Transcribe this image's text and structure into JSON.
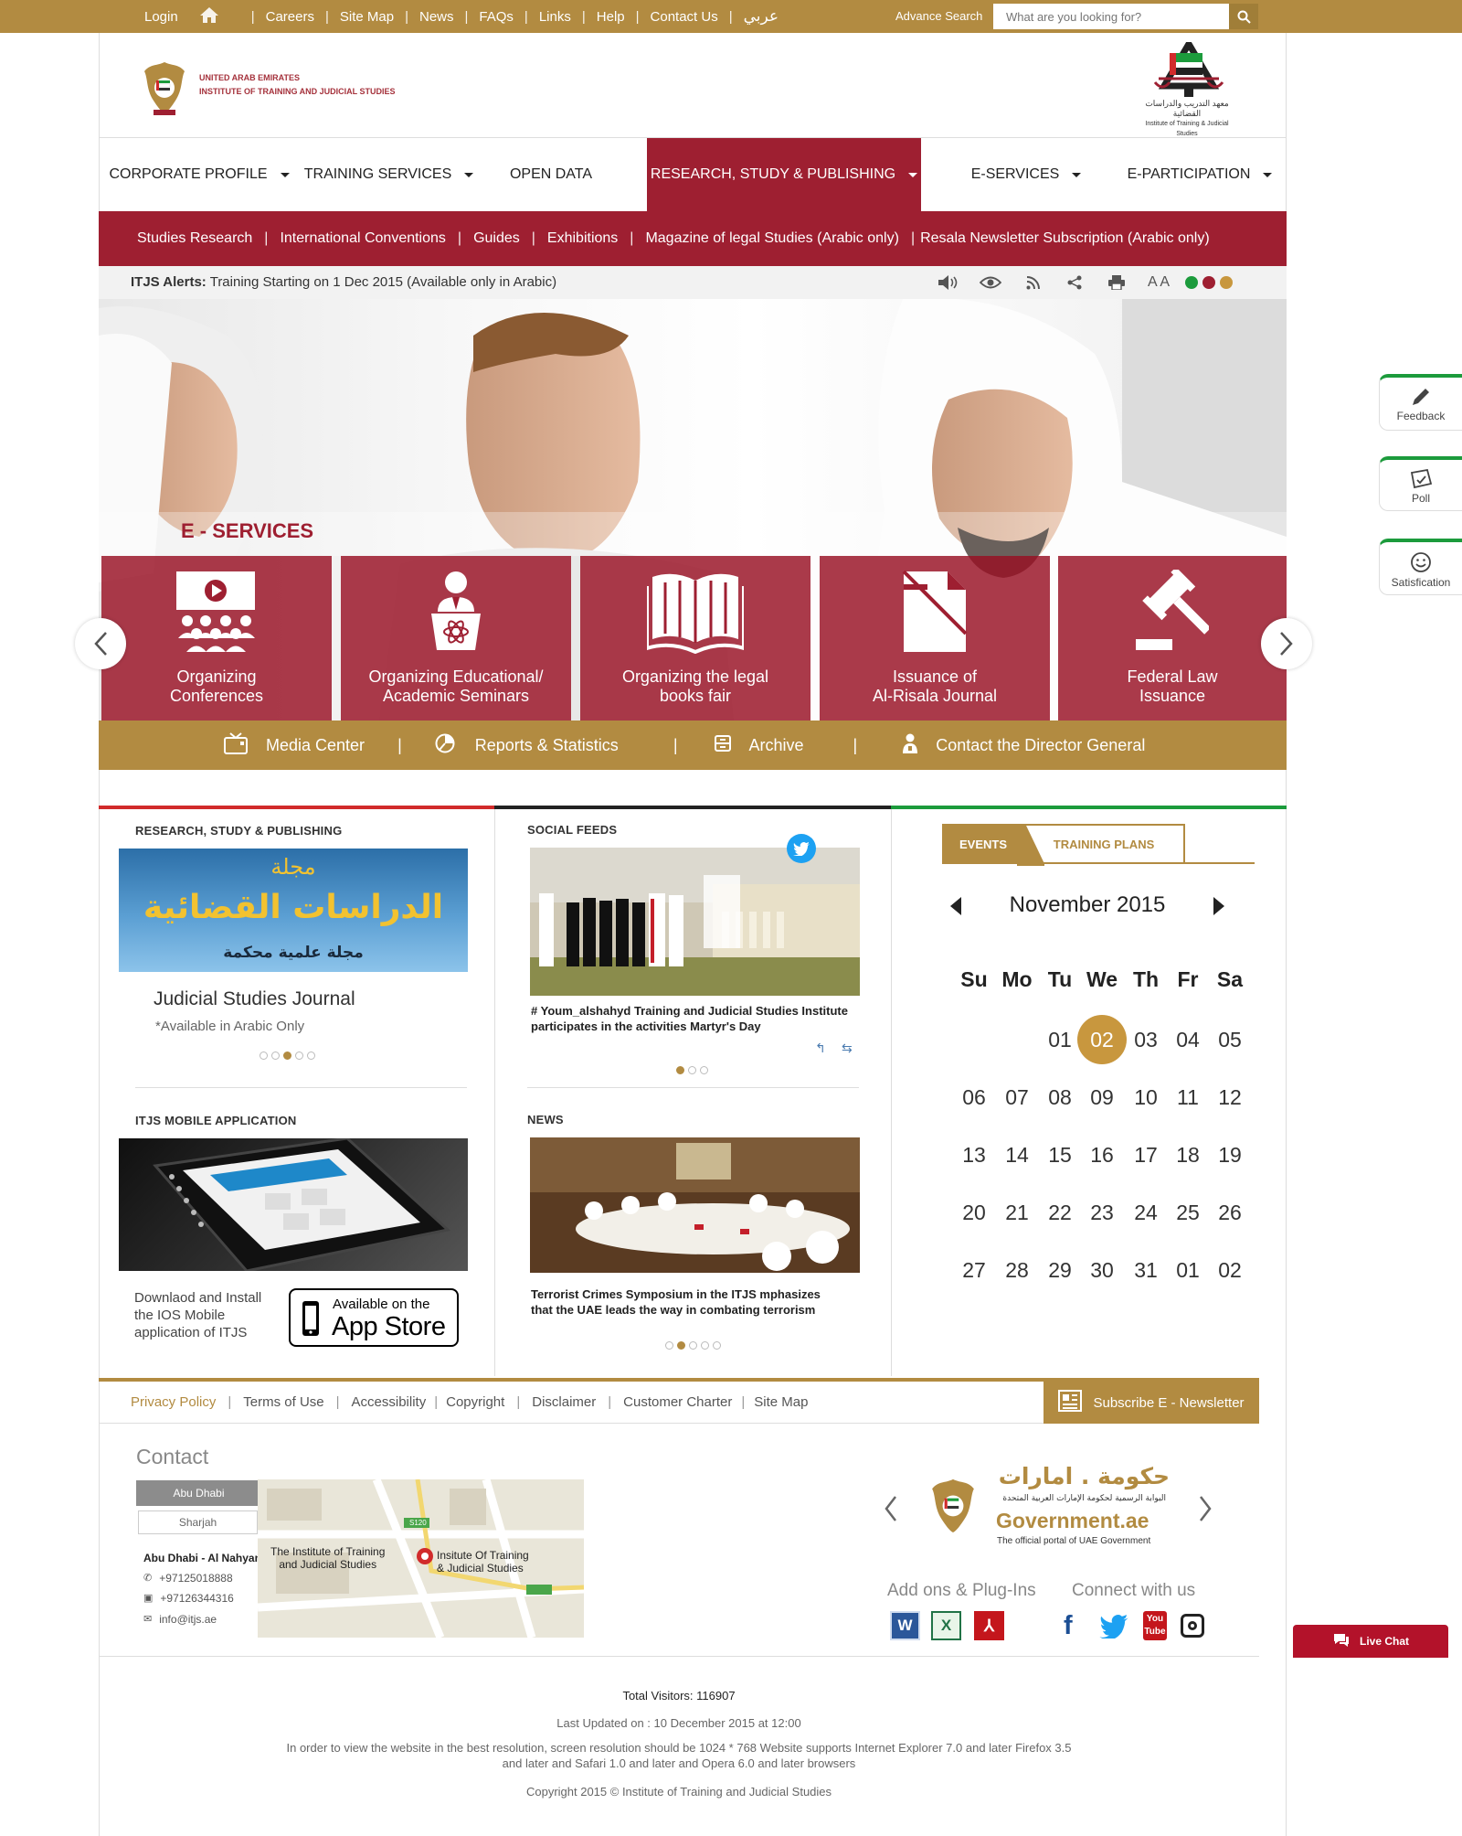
{
  "topbar": {
    "links": [
      "Login",
      "Careers",
      "Site Map",
      "News",
      "FAQs",
      "Links",
      "Help",
      "Contact Us",
      "عربي"
    ],
    "advance_search": "Advance Search",
    "search_placeholder": "What are you looking for?",
    "home_icon": "home-icon",
    "search_icon": "search-icon"
  },
  "header": {
    "logo_line1": "UNITED ARAB EMIRATES",
    "logo_line2": "INSTITUTE OF TRAINING AND JUDICIAL STUDIES",
    "logo_right_ar": "معهد التدريب والدراسات القضائية",
    "logo_right_en": "Institute of Training & Judicial Studies"
  },
  "mainnav": {
    "items": [
      {
        "label": "CORPORATE PROFILE",
        "dropdown": true
      },
      {
        "label": "TRAINING SERVICES",
        "dropdown": true
      },
      {
        "label": "OPEN DATA",
        "dropdown": false
      },
      {
        "label": "RESEARCH, STUDY & PUBLISHING",
        "dropdown": true,
        "active": true
      },
      {
        "label": "E-SERVICES",
        "dropdown": true
      },
      {
        "label": "E-PARTICIPATION",
        "dropdown": true
      }
    ]
  },
  "subnav": {
    "items": [
      "Studies Research",
      "International Conventions",
      "Guides",
      "Exhibitions",
      "Magazine of legal Studies (Arabic only)",
      "Resala Newsletter Subscription (Arabic only)"
    ]
  },
  "alerts": {
    "label": "ITJS Alerts:",
    "text": " Training Starting on 1 Dec 2015 (Available only in Arabic)",
    "font_size_label": "A A",
    "tools": [
      "speaker-icon",
      "eye-icon",
      "rss-icon",
      "share-icon",
      "print-icon"
    ],
    "theme_colors": [
      "#1c9b3c",
      "#9e1f31",
      "#c8973e"
    ]
  },
  "eservices": {
    "title": "E - SERVICES",
    "tiles": [
      {
        "label": "Organizing\nConferences",
        "icon": "conference-icon"
      },
      {
        "label": "Organizing Educational/\nAcademic Seminars",
        "icon": "seminar-icon"
      },
      {
        "label": "Organizing the legal\nbooks fair",
        "icon": "book-icon"
      },
      {
        "label": "Issuance of\nAl-Risala Journal",
        "icon": "journal-icon"
      },
      {
        "label": "Federal Law\nIssuance",
        "icon": "gavel-icon"
      }
    ]
  },
  "goldbar": {
    "items": [
      {
        "label": "Media Center",
        "icon": "tv-icon"
      },
      {
        "label": "Reports & Statistics",
        "icon": "chart-icon"
      },
      {
        "label": "Archive",
        "icon": "archive-icon"
      },
      {
        "label": "Contact the Director General",
        "icon": "person-icon"
      }
    ]
  },
  "research": {
    "heading": "RESEARCH, STUDY & PUBLISHING",
    "banner_ar_1": "مجلة",
    "banner_ar_2": "الدراسات القضائية",
    "banner_ar_3": "مجلة علمية محكمة",
    "title": "Judicial Studies Journal",
    "note": "*Available in Arabic Only"
  },
  "mobile": {
    "heading": "ITJS MOBILE APPLICATION",
    "text": "Downlaod and Install the IOS Mobile application of ITJS",
    "badge_small": "Available on the",
    "badge_big": "App Store"
  },
  "social": {
    "heading": "SOCIAL FEEDS",
    "caption": "# Youm_alshahyd Training and Judicial Studies Institute participates in the activities Martyr's Day"
  },
  "news": {
    "heading": "NEWS",
    "caption": "Terrorist Crimes Symposium in the ITJS mphasizes that the UAE leads the way in combating terrorism"
  },
  "events": {
    "tab_events": "EVENTS",
    "tab_training": "TRAINING PLANS",
    "month": "November 2015",
    "weekdays": [
      "Su",
      "Mo",
      "Tu",
      "We",
      "Th",
      "Fr",
      "Sa"
    ],
    "weeks": [
      [
        "",
        "",
        "01",
        "02",
        "03",
        "04",
        "05"
      ],
      [
        "06",
        "07",
        "08",
        "09",
        "10",
        "11",
        "12"
      ],
      [
        "13",
        "14",
        "15",
        "16",
        "17",
        "18",
        "19"
      ],
      [
        "20",
        "21",
        "22",
        "23",
        "24",
        "25",
        "26"
      ],
      [
        "27",
        "28",
        "29",
        "30",
        "31",
        "01",
        "02"
      ]
    ],
    "selected": "02"
  },
  "footer": {
    "links": [
      "Privacy Policy",
      "Terms of Use",
      "Accessibility",
      "Copyright",
      "Disclaimer",
      "Customer Charter",
      "Site Map"
    ],
    "subscribe": "Subscribe E - Newsletter",
    "contact_title": "Contact",
    "city_tabs": [
      "Abu Dhabi",
      "Sharjah"
    ],
    "address": "Abu Dhabi - Al Nahyan",
    "phone": "+97125018888",
    "fax": "+97126344316",
    "email": "info@itjs.ae",
    "map_label_1": "The Institute of Training\nand Judicial Studies",
    "map_label_2": "Insitute Of Training\n& Judicial Studies",
    "map_road": "S120",
    "gov_ar": "حكومة . امارات",
    "gov_ar_sub": "البوابة الرسمية لحكومة الإمارات العربية المتحدة",
    "gov_en": "Government.ae",
    "gov_en_sub": "The official portal of UAE Government",
    "addons_title": "Add ons & Plug-Ins",
    "connect_title": "Connect with us",
    "visitors": "Total Visitors: 116907",
    "updated": "Last Updated on : 10 December 2015 at 12:00",
    "resolution_note": "In order to view the website in the best resolution, screen resolution should be 1024 * 768 Website supports Internet Explorer 7.0 and later Firefox 3.5 and later and Safari 1.0 and later and Opera 6.0 and later browsers",
    "copyright": "Copyright 2015 © Institute of Training and Judicial Studies"
  },
  "sidewidgets": [
    "Feedback",
    "Poll",
    "Satisfication"
  ],
  "livechat": "Live Chat",
  "colors": {
    "gold": "#b28b41",
    "maroon": "#9e1f31",
    "green": "#1c9b3c",
    "red": "#d12b2b"
  }
}
